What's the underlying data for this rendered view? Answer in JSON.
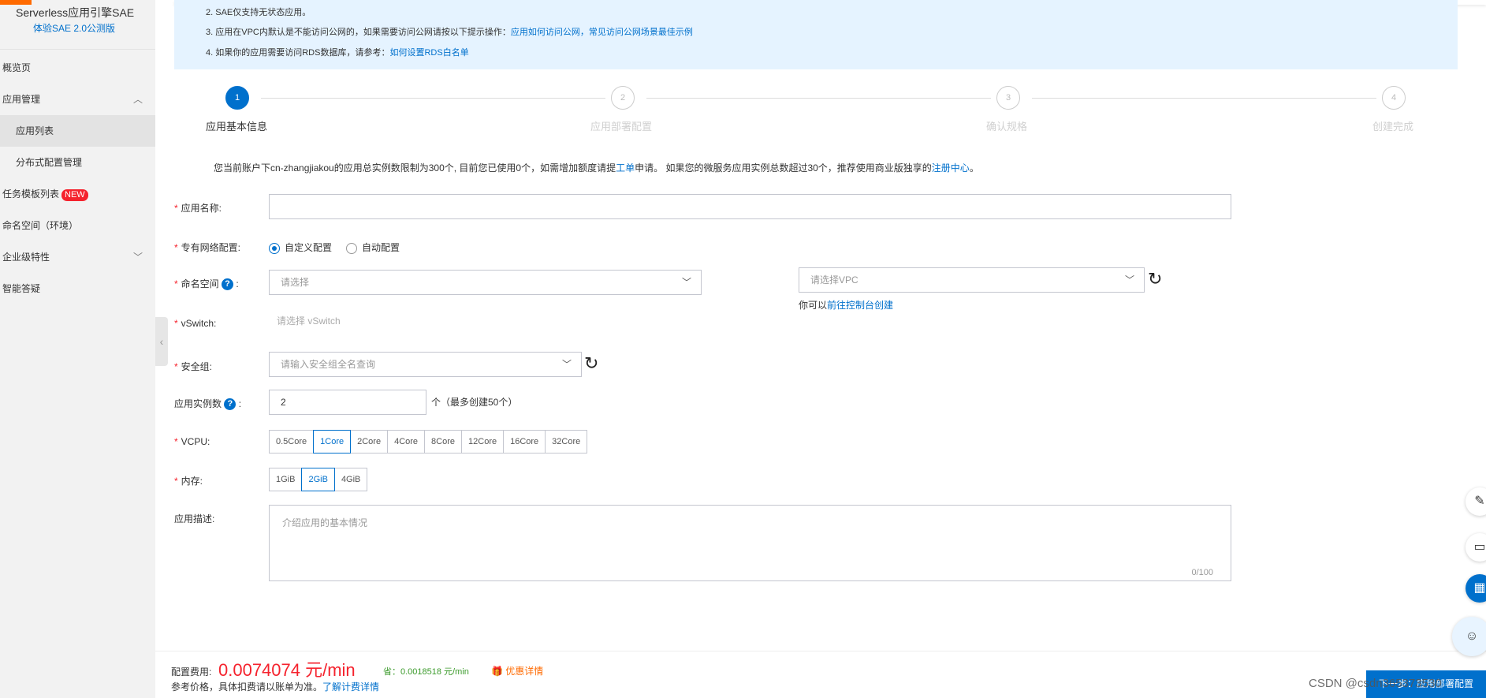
{
  "sidebar": {
    "title": "Serverless应用引擎SAE",
    "subtitle": "体验SAE 2.0公测版",
    "items": [
      {
        "label": "概览页"
      },
      {
        "label": "应用管理"
      },
      {
        "label": "应用列表"
      },
      {
        "label": "分布式配置管理"
      },
      {
        "label": "任务模板列表",
        "badge": "NEW"
      },
      {
        "label": "命名空间（环境）"
      },
      {
        "label": "企业级特性"
      },
      {
        "label": "智能答疑"
      }
    ]
  },
  "notice": {
    "line2": "2. SAE仅支持无状态应用。",
    "line3_text": "3. 应用在VPC内默认是不能访问公网的，如果需要访问公网请按以下提示操作：",
    "line3_link1": "应用如何访问公网",
    "line3_sep": "，",
    "line3_link2": "常见访问公网场景最佳示例",
    "line4_text": "4. 如果你的应用需要访问RDS数据库，请参考：",
    "line4_link": "如何设置RDS白名单"
  },
  "steps": [
    {
      "num": "1",
      "label": "应用基本信息",
      "active": true
    },
    {
      "num": "2",
      "label": "应用部署配置",
      "active": false
    },
    {
      "num": "3",
      "label": "确认规格",
      "active": false
    },
    {
      "num": "4",
      "label": "创建完成",
      "active": false
    }
  ],
  "quota": {
    "text1": "您当前账户下cn-zhangjiakou的应用总实例数限制为300个, 目前您已使用0个，如需增加额度请提",
    "link1": "工单",
    "text2": "申请。 如果您的微服务应用实例总数超过30个，推荐使用商业版独享的",
    "link2": "注册中心",
    "text3": "。"
  },
  "form": {
    "app_name_label": "应用名称:",
    "vpc_label": "专有网络配置:",
    "vpc_options": [
      "自定义配置",
      "自动配置"
    ],
    "vpc_selected": "自定义配置",
    "namespace_label": "命名空间",
    "namespace_placeholder": "请选择",
    "vpc_select_placeholder": "请选择VPC",
    "vpc_hint_text": "你可以",
    "vpc_hint_link": "前往控制台创建",
    "vswitch_label": "vSwitch:",
    "vswitch_placeholder": "请选择 vSwitch",
    "sg_label": "安全组:",
    "sg_placeholder": "请输入安全组全名查询",
    "instances_label": "应用实例数",
    "instances_value": "2",
    "instances_hint": "个（最多创建50个）",
    "vcpu_label": "VCPU:",
    "vcpu_options": [
      "0.5Core",
      "1Core",
      "2Core",
      "4Core",
      "8Core",
      "12Core",
      "16Core",
      "32Core"
    ],
    "vcpu_selected": "1Core",
    "mem_label": "内存:",
    "mem_options": [
      "1GiB",
      "2GiB",
      "4GiB"
    ],
    "mem_selected": "2GiB",
    "desc_label": "应用描述:",
    "desc_placeholder": "介绍应用的基本情况",
    "desc_counter": "0/100"
  },
  "footer": {
    "cost_label": "配置费用:",
    "price": "0.0074074 元/min",
    "save": "省：0.0018518 元/min",
    "promo": "优惠详情",
    "note": "参考价格，具体扣费请以账单为准。",
    "note_link": "了解计费详情",
    "next_button": "下一步：应用部署配置"
  },
  "watermark": "CSDN @csdn365373530",
  "colors": {
    "primary": "#0070cc",
    "danger": "#f5222d",
    "notice_bg": "#e5f3ff",
    "brand": "#ff6a00"
  }
}
